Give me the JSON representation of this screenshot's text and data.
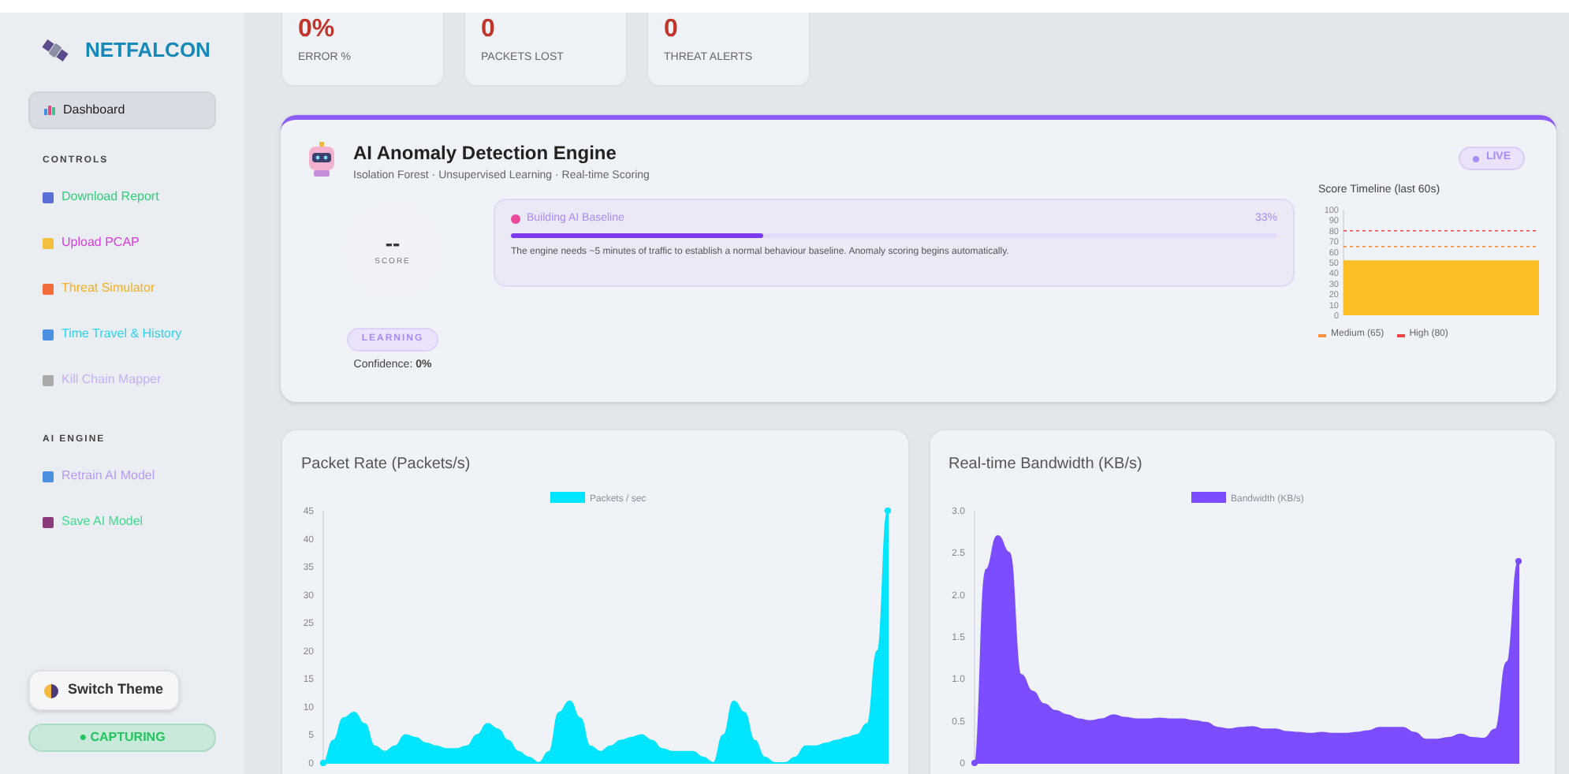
{
  "sidebar": {
    "brand": "NETFALCON",
    "items": [
      {
        "label": "Dashboard",
        "selected": true
      }
    ],
    "sections": [
      {
        "title": "CONTROLS",
        "items": [
          {
            "label": "Download Report",
            "color": "#2fd07a"
          },
          {
            "label": "Upload PCAP",
            "color": "#d93be0"
          },
          {
            "label": "Threat Simulator",
            "color": "#f5b01b"
          },
          {
            "label": "Time Travel & History",
            "color": "#2ad4ee"
          },
          {
            "label": "Kill Chain Mapper",
            "color": "#c3b2f7"
          }
        ]
      },
      {
        "title": "AI ENGINE",
        "items": [
          {
            "label": "Retrain AI Model",
            "color": "#b59cf5"
          },
          {
            "label": "Save AI Model",
            "color": "#3fdc8f"
          }
        ]
      }
    ],
    "theme_button": "Switch Theme",
    "capture_status": "● CAPTURING"
  },
  "stats": [
    {
      "value": "0%",
      "label": "ERROR %"
    },
    {
      "value": "0",
      "label": "PACKETS LOST"
    },
    {
      "value": "0",
      "label": "THREAT ALERTS"
    }
  ],
  "ai_engine": {
    "title": "AI Anomaly Detection Engine",
    "subtitle": "Isolation Forest · Unsupervised Learning · Real-time Scoring",
    "live": "LIVE",
    "score": "--",
    "score_label": "SCORE",
    "state": "LEARNING",
    "confidence": "Confidence: **0%**",
    "baseline": {
      "title": "Building AI Baseline",
      "percent": "33%",
      "level": 0.33,
      "note": "The engine needs ~5 minutes of traffic to establish a normal behaviour baseline. Anomaly scoring begins automatically."
    },
    "timeline": {
      "title": "Score Timeline (last 60s)",
      "chart_data": {
        "type": "bar",
        "values": [
          52
        ],
        "ylim": [
          0,
          100
        ],
        "yticks": [
          0,
          10,
          20,
          30,
          40,
          50,
          60,
          70,
          80,
          90,
          100
        ],
        "ref_lines": [
          {
            "axis": "y",
            "value": 65,
            "label": "Medium (65)",
            "color": "#fb923c"
          },
          {
            "axis": "y",
            "value": 80,
            "label": "High (80)",
            "color": "#ef4444"
          }
        ]
      }
    }
  },
  "charts": [
    {
      "title": "Packet Rate (Packets/s)",
      "chart_data": {
        "type": "area",
        "ylim": [
          0,
          45
        ],
        "yticks": [
          0,
          5,
          10,
          15,
          20,
          25,
          30,
          35,
          40,
          45
        ],
        "series": [
          {
            "name": "Packets / sec",
            "color": "#00e5ff",
            "values": [
              0,
              4,
              8,
              9,
              7,
              3,
              2,
              3,
              5,
              4.5,
              3.5,
              3,
              2.5,
              2.5,
              3,
              5,
              7,
              6,
              4,
              2,
              1,
              0,
              2,
              9,
              11,
              8,
              3,
              2,
              3,
              4,
              4.5,
              5,
              4,
              2.5,
              2,
              2,
              2,
              1,
              0,
              5,
              11,
              9,
              4,
              1,
              0,
              0,
              1,
              3,
              3,
              3.5,
              4,
              4.5,
              5,
              7,
              20,
              45
            ]
          }
        ]
      }
    },
    {
      "title": "Real-time Bandwidth (KB/s)",
      "chart_data": {
        "type": "area",
        "ylim": [
          0,
          3
        ],
        "yticks": [
          {
            "value": 0,
            "label": "0"
          },
          {
            "value": 0.5,
            "label": "0.5"
          },
          {
            "value": 1,
            "label": "1.0"
          },
          {
            "value": 1.5,
            "label": "1.5"
          },
          {
            "value": 2,
            "label": "2.0"
          },
          {
            "value": 2.5,
            "label": "2.5"
          },
          {
            "value": 3,
            "label": "3.0"
          }
        ],
        "series": [
          {
            "name": "Bandwidth (KB/s)",
            "color": "#7c4dff",
            "values": [
              0,
              2.3,
              2.7,
              2.5,
              1.05,
              0.85,
              0.7,
              0.62,
              0.57,
              0.52,
              0.5,
              0.52,
              0.57,
              0.54,
              0.52,
              0.52,
              0.53,
              0.52,
              0.52,
              0.5,
              0.48,
              0.42,
              0.4,
              0.42,
              0.43,
              0.4,
              0.4,
              0.37,
              0.36,
              0.35,
              0.36,
              0.35,
              0.35,
              0.36,
              0.38,
              0.42,
              0.42,
              0.42,
              0.36,
              0.28,
              0.28,
              0.3,
              0.34,
              0.3,
              0.29,
              0.4,
              1.2,
              2.4
            ]
          }
        ]
      }
    }
  ]
}
